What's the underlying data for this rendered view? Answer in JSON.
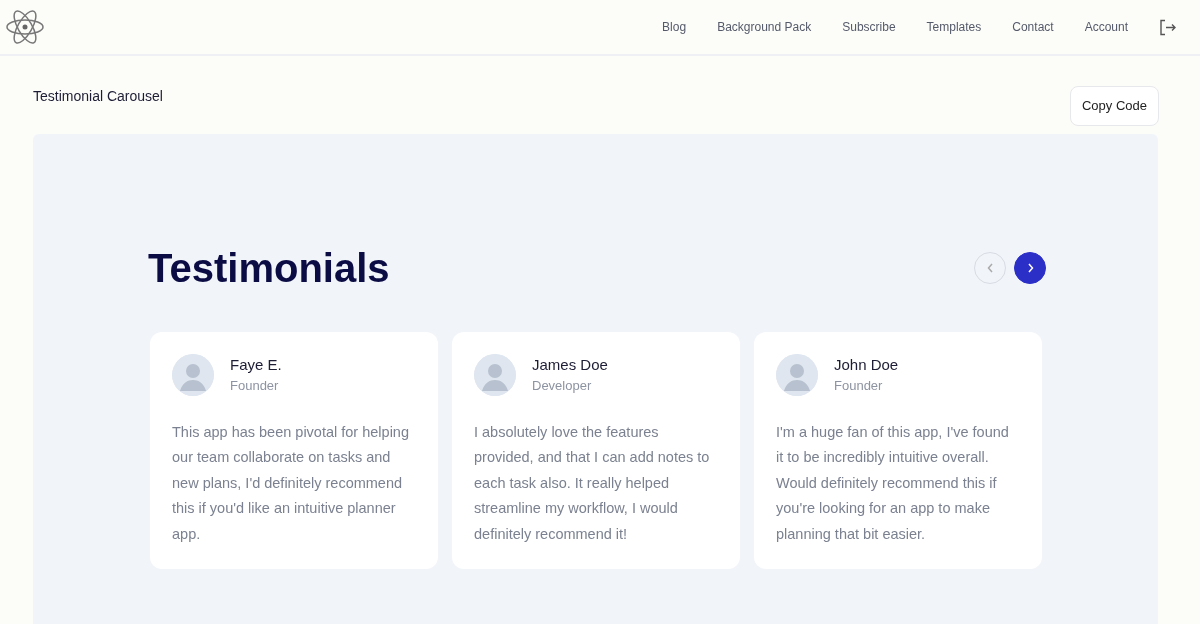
{
  "nav": {
    "links": [
      "Blog",
      "Background Pack",
      "Subscribe",
      "Templates",
      "Contact",
      "Account"
    ]
  },
  "page": {
    "title": "Testimonial Carousel",
    "copy_button": "Copy Code"
  },
  "section": {
    "heading": "Testimonials",
    "controls": [
      {
        "kind": "prev",
        "active": false
      },
      {
        "kind": "next",
        "active": true
      }
    ],
    "testimonials": [
      {
        "name": "Faye E.",
        "role": "Founder",
        "quote": "This app has been pivotal for helping our team collaborate on tasks and new plans, I'd definitely recommend this if you'd like an intuitive planner app."
      },
      {
        "name": "James Doe",
        "role": "Developer",
        "quote": "I absolutely love the features provided, and that I can add notes to each task also. It really helped streamline my workflow, I would definitely recommend it!"
      },
      {
        "name": "John Doe",
        "role": "Founder",
        "quote": "I'm a huge fan of this app, I've found it to be incredibly intuitive overall. Would definitely recommend this if you're looking for an app to make planning that bit easier."
      }
    ]
  }
}
